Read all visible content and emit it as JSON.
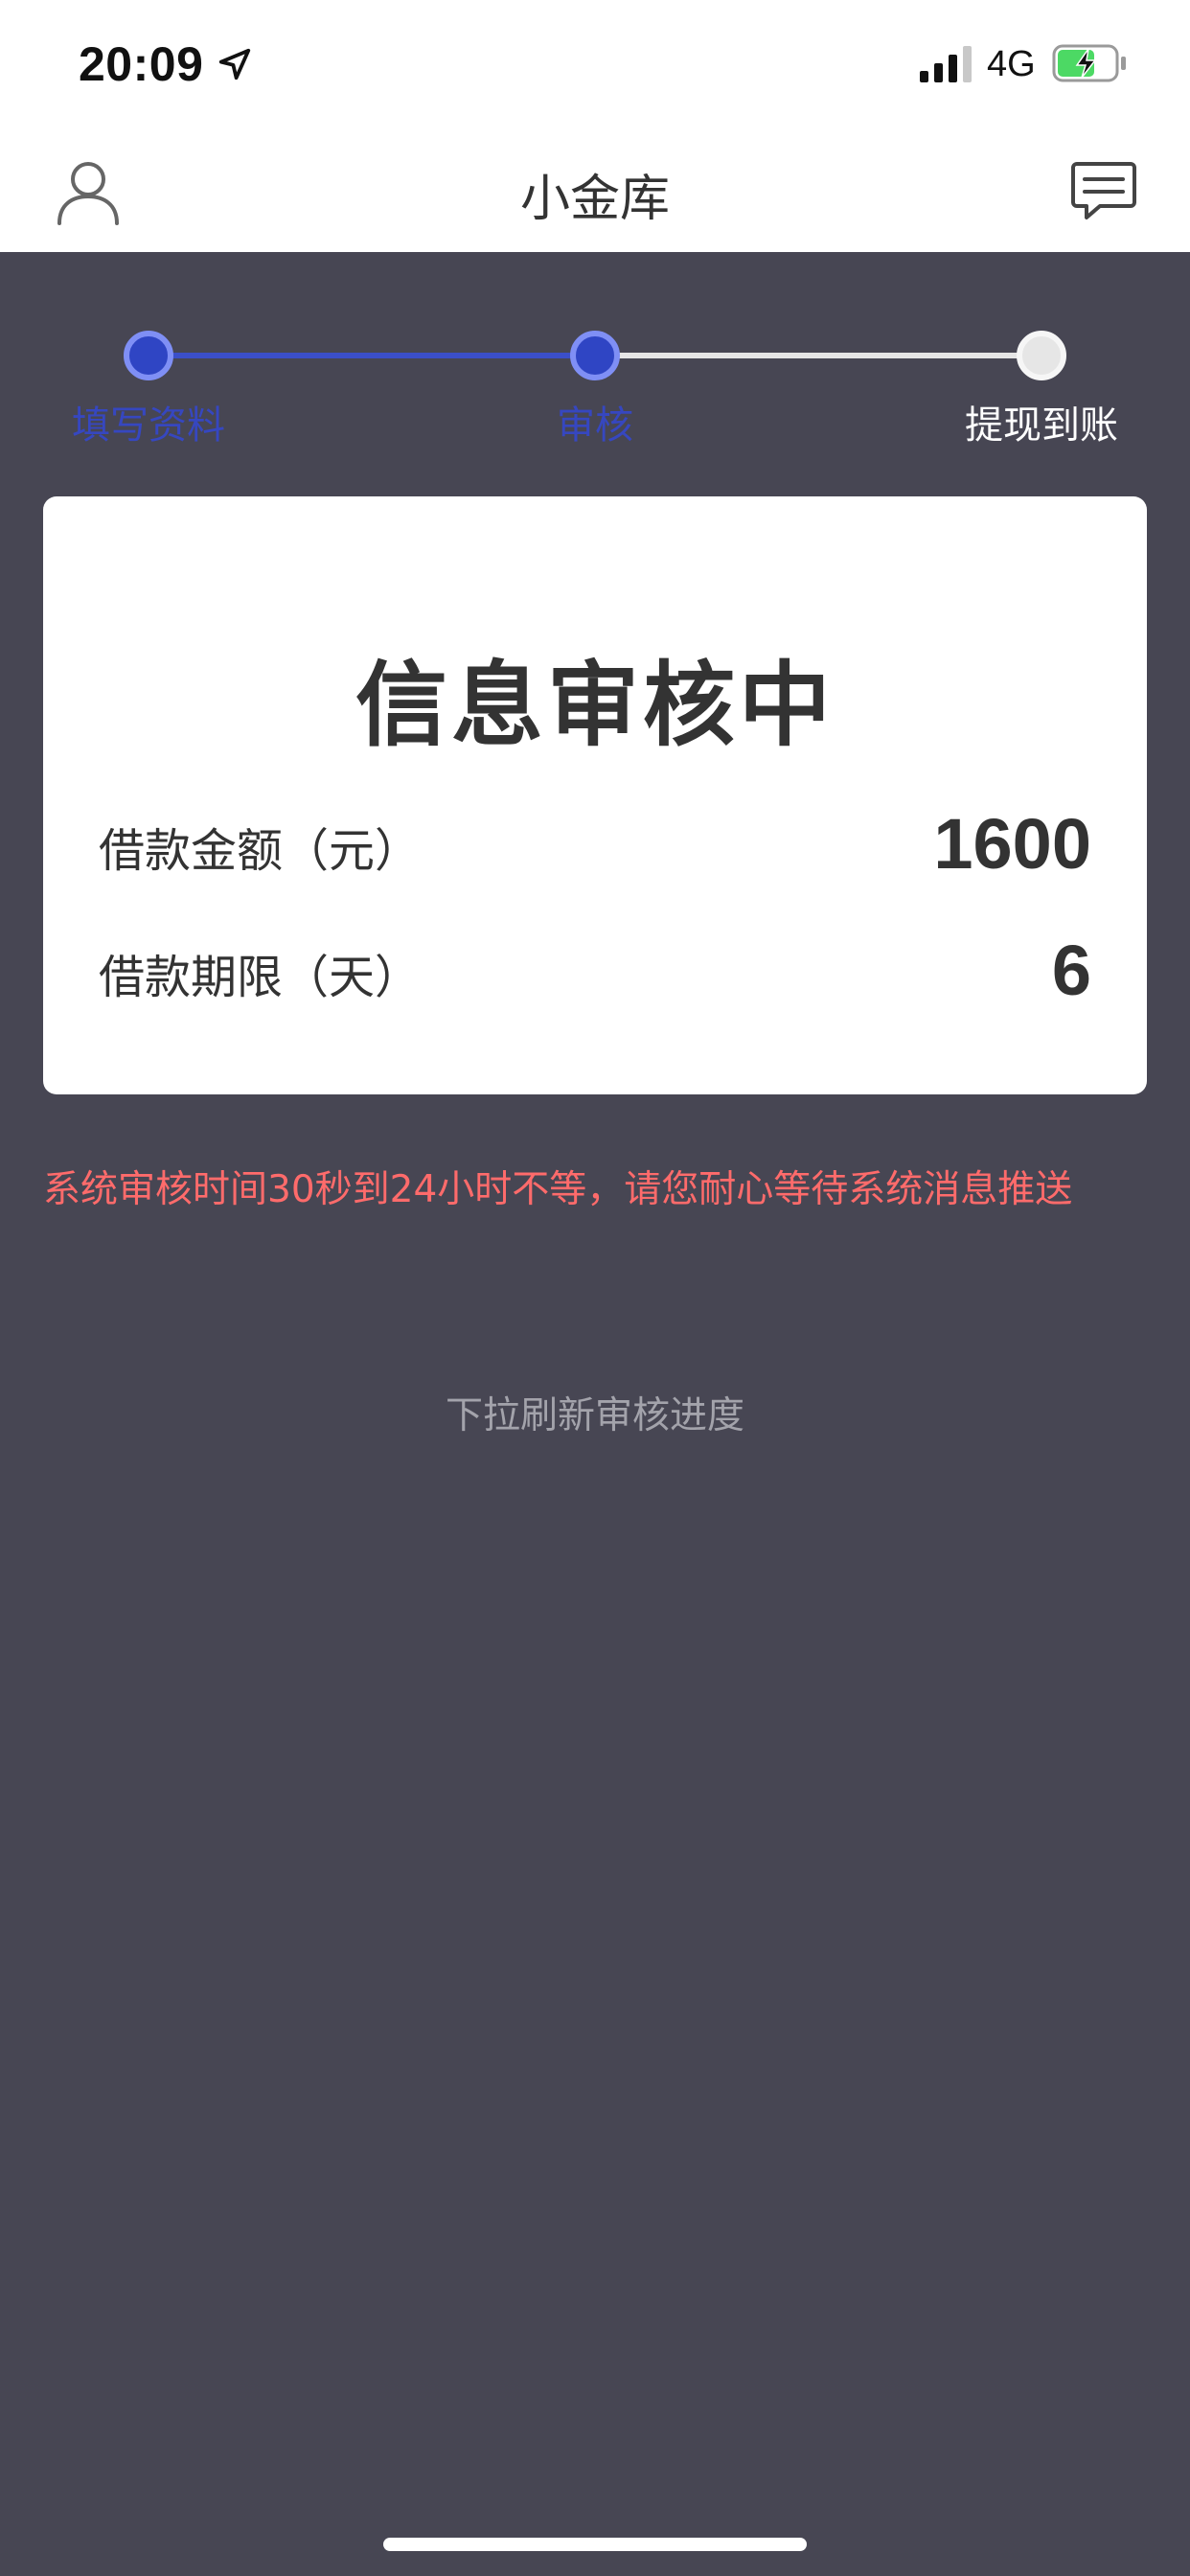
{
  "status_bar": {
    "time": "20:09",
    "network": "4G",
    "icons": [
      "location-arrow-icon",
      "signal-icon",
      "battery-charging-icon"
    ]
  },
  "nav": {
    "title": "小金库",
    "left_icon": "user-icon",
    "right_icon": "message-icon"
  },
  "steps": [
    {
      "label": "填写资料",
      "state": "done"
    },
    {
      "label": "审核",
      "state": "current"
    },
    {
      "label": "提现到账",
      "state": "pending"
    }
  ],
  "card": {
    "title": "信息审核中",
    "rows": [
      {
        "label": "借款金额（元）",
        "value": "1600"
      },
      {
        "label": "借款期限（天）",
        "value": "6"
      }
    ]
  },
  "notice": "系统审核时间30秒到24小时不等，请您耐心等待系统消息推送",
  "hint": "下拉刷新审核进度",
  "colors": {
    "background": "#474653",
    "accent": "#2f45c4",
    "notice": "#ff6b6b",
    "card": "#ffffff"
  }
}
